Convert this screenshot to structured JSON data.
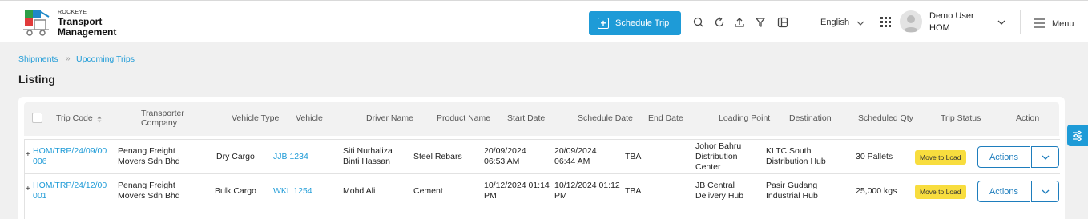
{
  "header": {
    "brand_small": "ROCKEYE",
    "brand_line1": "Transport",
    "brand_line2": "Management",
    "schedule_trip_label": "Schedule Trip",
    "language": "English",
    "user_name": "Demo User",
    "user_org": "HOM",
    "menu_label": "Menu",
    "accent_color": "#1e9bd7"
  },
  "breadcrumb": {
    "items": [
      "Shipments",
      "Upcoming Trips"
    ]
  },
  "page": {
    "title": "Listing"
  },
  "table": {
    "columns": [
      "Trip Code",
      "Transporter Company",
      "Vehicle Type",
      "Vehicle",
      "Driver Name",
      "Product Name",
      "Start Date",
      "Schedule Date",
      "End Date",
      "Loading Point",
      "Destination",
      "Scheduled Qty",
      "Trip Status",
      "Action"
    ],
    "rows": [
      {
        "trip_code": "HOM/TRP/24/09/00 006",
        "transporter": "Penang Freight Movers Sdn Bhd",
        "vehicle_type": "Dry Cargo",
        "vehicle": "JJB 1234",
        "driver": "Siti Nurhaliza Binti Hassan",
        "product": "Steel Rebars",
        "start_date": "20/09/2024 06:53 AM",
        "schedule_date": "20/09/2024 06:44 AM",
        "end_date": "TBA",
        "loading_point": "Johor Bahru Distribution Center",
        "destination": "KLTC South Distribution Hub",
        "qty": "30 Pallets",
        "status": "Move to Load",
        "action": "Actions"
      },
      {
        "trip_code": "HOM/TRP/24/12/00 001",
        "transporter": "Penang Freight Movers Sdn Bhd",
        "vehicle_type": "Bulk Cargo",
        "vehicle": "WKL 1254",
        "driver": "Mohd Ali",
        "product": "Cement",
        "start_date": "10/12/2024 01:14 PM",
        "schedule_date": "10/12/2024 01:12 PM",
        "end_date": "TBA",
        "loading_point": "JB Central Delivery Hub",
        "destination": "Pasir Gudang Industrial Hub",
        "qty": "25,000 kgs",
        "status": "Move to Load",
        "action": "Actions"
      }
    ]
  },
  "icons": [
    "logo-icon",
    "plus-icon",
    "search-icon",
    "refresh-icon",
    "upload-icon",
    "filter-icon",
    "columns-icon",
    "chevron-down-icon",
    "apps-grid-icon",
    "avatar",
    "hamburger-menu-icon",
    "sort-icon",
    "filter-settings-icon"
  ]
}
